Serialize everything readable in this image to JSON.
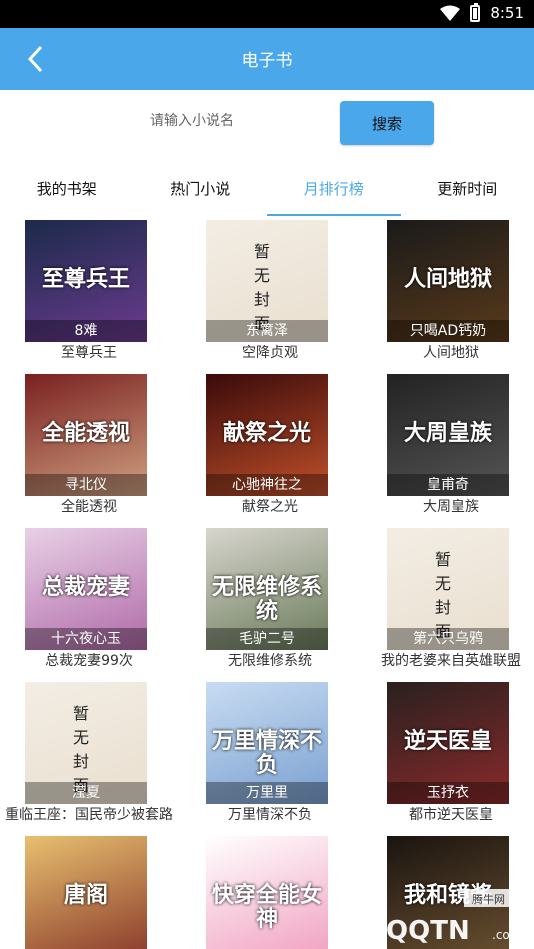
{
  "status": {
    "time": "8:51"
  },
  "appbar": {
    "title": "电子书"
  },
  "search": {
    "placeholder": "请输入小说名",
    "button": "搜索"
  },
  "tabs": [
    {
      "label": "我的书架",
      "active": false
    },
    {
      "label": "热门小说",
      "active": false
    },
    {
      "label": "月排行榜",
      "active": true
    },
    {
      "label": "更新时间",
      "active": false
    }
  ],
  "books": [
    {
      "name": "至尊兵王",
      "author": "8难",
      "cover_text": "至尊兵王"
    },
    {
      "name": "空降贞观",
      "author": "东篱泽",
      "cover_text": "暂无封面"
    },
    {
      "name": "人间地狱",
      "author": "只喝AD钙奶",
      "cover_text": "人间地狱"
    },
    {
      "name": "全能透视",
      "author": "寻北仪",
      "cover_text": "全能透视"
    },
    {
      "name": "献祭之光",
      "author": "心驰神往之",
      "cover_text": "献祭之光"
    },
    {
      "name": "大周皇族",
      "author": "皇甫奇",
      "cover_text": "大周皇族"
    },
    {
      "name": "总裁宠妻99次",
      "author": "十六夜心玉",
      "cover_text": "总裁宠妻"
    },
    {
      "name": "无限维修系统",
      "author": "毛驴二号",
      "cover_text": "无限维修系统"
    },
    {
      "name": "我的老婆来自英雄联盟",
      "author": "第六只乌鸦",
      "cover_text": "暂无封面"
    },
    {
      "name": "重临王座：国民帝少被套路",
      "author": "滢夏",
      "cover_text": "暂无封面"
    },
    {
      "name": "万里情深不负",
      "author": "万里里",
      "cover_text": "万里情深不负"
    },
    {
      "name": "都市逆天医皇",
      "author": "玉抒衣",
      "cover_text": "逆天医皇"
    },
    {
      "name": "",
      "author": "",
      "cover_text": "唐阁"
    },
    {
      "name": "",
      "author": "",
      "cover_text": "快穿全能女神"
    },
    {
      "name": "",
      "author": "",
      "cover_text": "我和镜酱"
    }
  ],
  "watermark": {
    "text": "QQTN.com",
    "sub": "腾牛网"
  }
}
